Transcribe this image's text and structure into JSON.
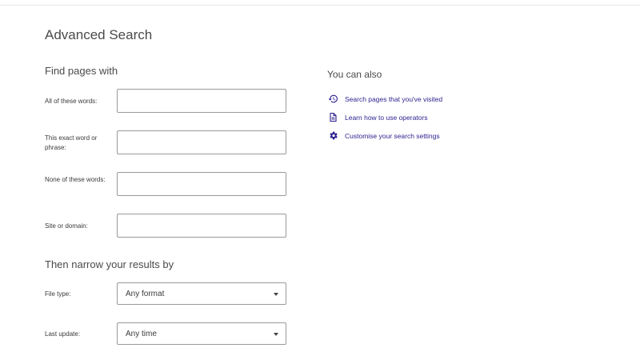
{
  "page": {
    "title": "Advanced Search"
  },
  "find_section": {
    "heading": "Find pages with",
    "fields": [
      {
        "label": "All of these words:",
        "value": "",
        "placeholder": ""
      },
      {
        "label": "This exact word or phrase:",
        "value": "",
        "placeholder": ""
      },
      {
        "label": "None of these words:",
        "value": "",
        "placeholder": ""
      },
      {
        "label": "Site or domain:",
        "value": "",
        "placeholder": ""
      }
    ]
  },
  "narrow_section": {
    "heading": "Then narrow your results by",
    "file_type": {
      "label": "File type:",
      "selected": "Any format"
    },
    "last_update": {
      "label": "Last update:",
      "selected": "Any time"
    }
  },
  "sidebar": {
    "heading": "You can also",
    "links": [
      {
        "icon": "history-icon",
        "label": "Search pages that you've visited"
      },
      {
        "icon": "document-icon",
        "label": "Learn how to use operators"
      },
      {
        "icon": "gear-icon",
        "label": "Customise your search settings"
      }
    ]
  },
  "colors": {
    "link": "#2a1f8e",
    "icon": "#2a1f8e",
    "input_border": "#9a9a9a",
    "heading": "#4a4a4a"
  }
}
